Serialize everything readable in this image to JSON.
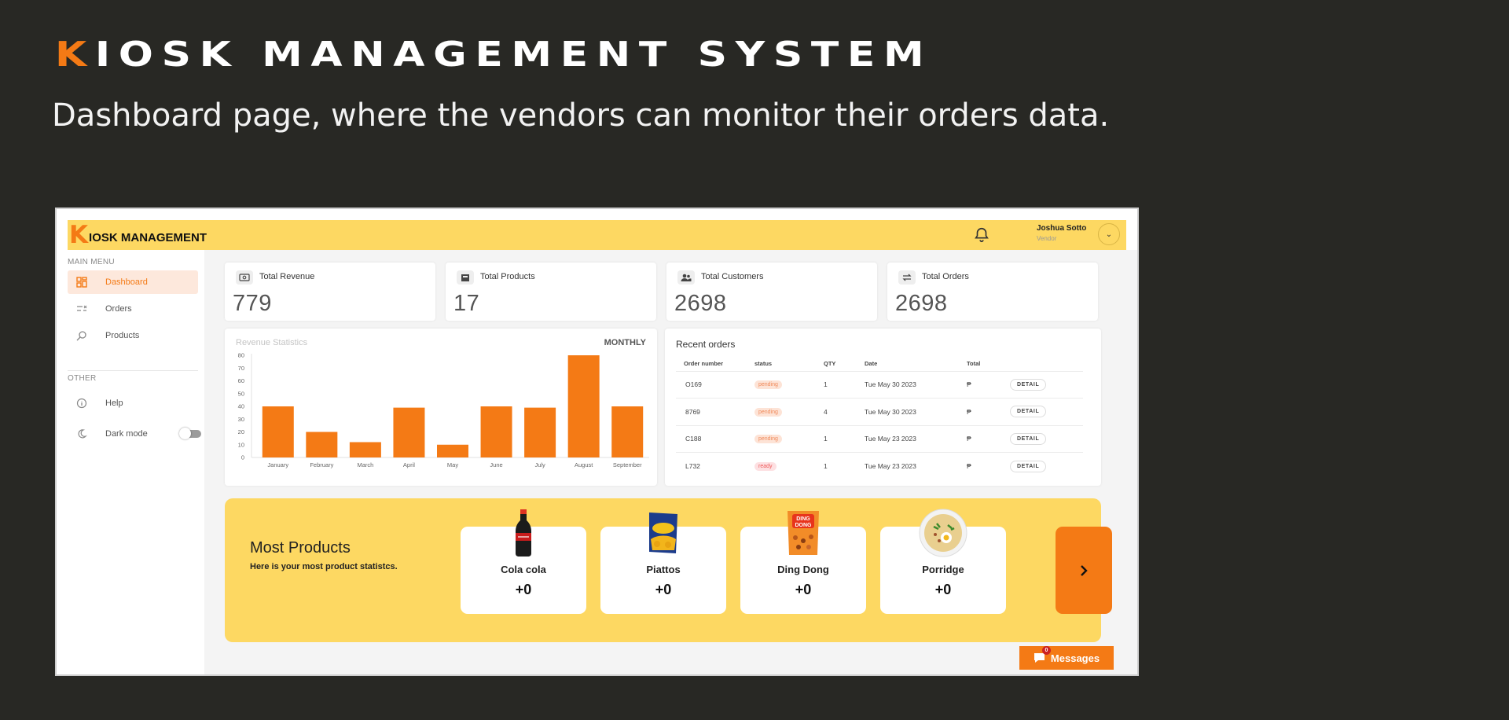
{
  "hero": {
    "title_first_letter": "K",
    "title_rest": "IOSK MANAGEMENT SYSTEM",
    "subtitle": "Dashboard page, where the vendors can monitor their orders data."
  },
  "app": {
    "logo_first": "K",
    "logo_rest": "IOSK MANAGEMENT",
    "user_name": "Joshua Sotto",
    "user_role": "Vendor"
  },
  "sidebar": {
    "main_menu_label": "MAIN MENU",
    "other_label": "OTHER",
    "items": [
      {
        "label": "Dashboard",
        "icon": "dashboard-icon"
      },
      {
        "label": "Orders",
        "icon": "orders-icon"
      },
      {
        "label": "Products",
        "icon": "search-icon"
      }
    ],
    "other_items": [
      {
        "label": "Help",
        "icon": "info-icon"
      },
      {
        "label": "Dark mode",
        "icon": "moon-icon"
      }
    ]
  },
  "stats": [
    {
      "label": "Total Revenue",
      "value": "779",
      "icon": "cash-icon"
    },
    {
      "label": "Total Products",
      "value": "17",
      "icon": "box-icon"
    },
    {
      "label": "Total Customers",
      "value": "2698",
      "icon": "users-icon"
    },
    {
      "label": "Total Orders",
      "value": "2698",
      "icon": "swap-icon"
    }
  ],
  "revenue": {
    "title": "Revenue Statistics",
    "mode": "MONTHLY"
  },
  "chart_data": {
    "type": "bar",
    "title": "Revenue Statistics",
    "categories": [
      "January",
      "February",
      "March",
      "April",
      "May",
      "June",
      "July",
      "August",
      "September"
    ],
    "values": [
      40,
      20,
      12,
      39,
      10,
      40,
      39,
      80,
      40
    ],
    "ylim": [
      0,
      80
    ],
    "yticks": [
      0,
      10,
      20,
      30,
      40,
      50,
      60,
      70,
      80
    ],
    "color": "#f47a15"
  },
  "orders": {
    "title": "Recent orders",
    "headers": [
      "Order number",
      "status",
      "QTY",
      "Date",
      "Total",
      ""
    ],
    "rows": [
      {
        "number": "O169",
        "status": "pending",
        "qty": "1",
        "date": "Tue May 30 2023",
        "total": "₱",
        "action": "DETAIL"
      },
      {
        "number": "8769",
        "status": "pending",
        "qty": "4",
        "date": "Tue May 30 2023",
        "total": "₱",
        "action": "DETAIL"
      },
      {
        "number": "C188",
        "status": "pending",
        "qty": "1",
        "date": "Tue May 23 2023",
        "total": "₱",
        "action": "DETAIL"
      },
      {
        "number": "L732",
        "status": "ready",
        "qty": "1",
        "date": "Tue May 23 2023",
        "total": "₱",
        "action": "DETAIL"
      }
    ]
  },
  "most": {
    "title": "Most Products",
    "subtitle": "Here is your most product statistcs.",
    "products": [
      {
        "name": "Cola cola",
        "count": "+0",
        "icon": "cola-bottle-icon"
      },
      {
        "name": "Piattos",
        "count": "+0",
        "icon": "chip-bag-icon"
      },
      {
        "name": "Ding Dong",
        "count": "+0",
        "icon": "snack-bag-icon"
      },
      {
        "name": "Porridge",
        "count": "+0",
        "icon": "porridge-bowl-icon"
      }
    ],
    "ding_dong_pack_text": [
      "DING",
      "DONG"
    ]
  },
  "messages": {
    "label": "Messages",
    "badge": "0"
  },
  "colors": {
    "accent": "#f47a15",
    "yellow": "#fdd862",
    "background": "#282824"
  }
}
